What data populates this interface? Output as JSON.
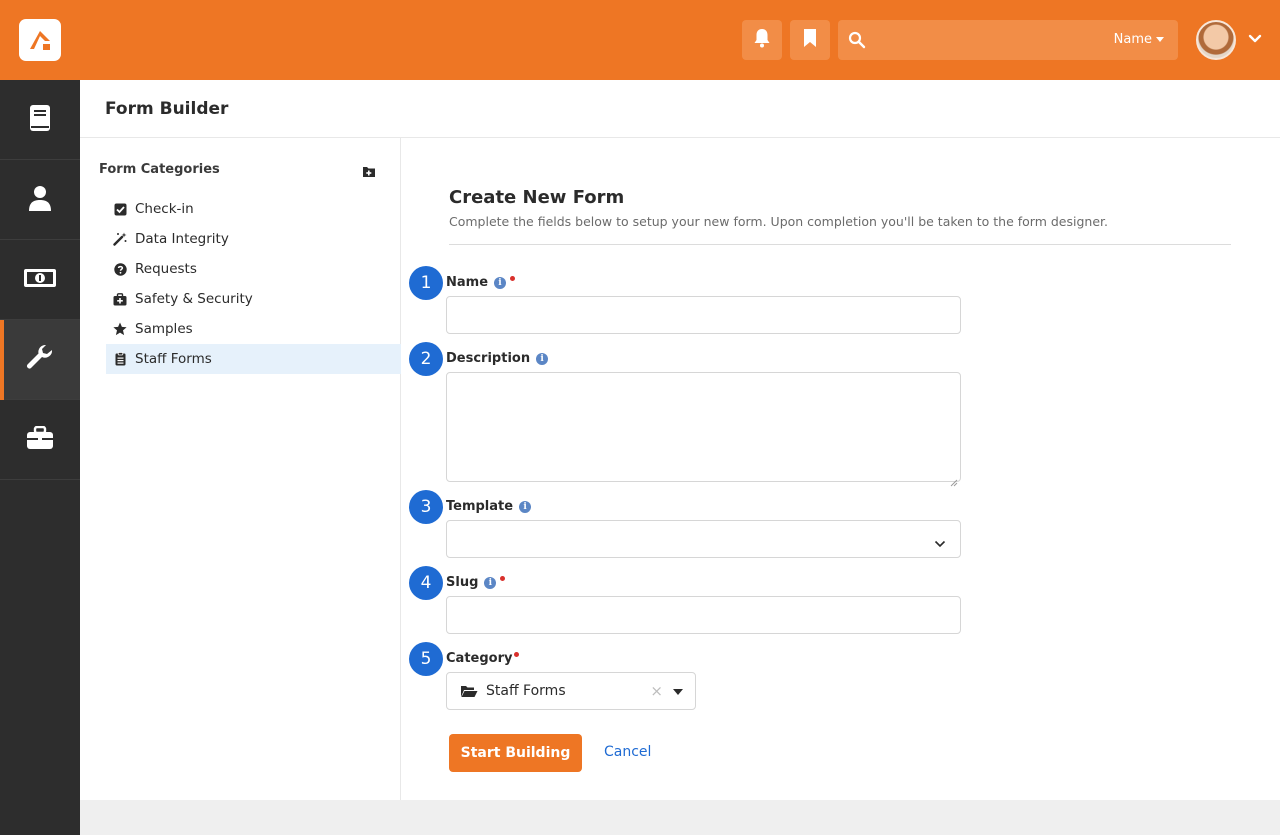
{
  "topbar": {
    "search_type_label": "Name",
    "icons": [
      "bell-icon",
      "bookmark-icon",
      "search-icon",
      "chevron-down-icon"
    ]
  },
  "sidebar": {
    "items": [
      {
        "icon": "book-icon"
      },
      {
        "icon": "person-icon"
      },
      {
        "icon": "money-icon"
      },
      {
        "icon": "wrench-icon",
        "active": true
      },
      {
        "icon": "briefcase-icon"
      }
    ]
  },
  "page": {
    "title": "Form Builder"
  },
  "categories": {
    "title": "Form Categories",
    "items": [
      {
        "label": "Check-in",
        "icon": "checkbox-icon"
      },
      {
        "label": "Data Integrity",
        "icon": "magic-wand-icon"
      },
      {
        "label": "Requests",
        "icon": "question-circle-icon"
      },
      {
        "label": "Safety & Security",
        "icon": "medkit-icon"
      },
      {
        "label": "Samples",
        "icon": "star-icon"
      },
      {
        "label": "Staff Forms",
        "icon": "clipboard-icon",
        "selected": true
      }
    ]
  },
  "form": {
    "title": "Create New Form",
    "subtitle": "Complete the fields below to setup your new form. Upon completion you'll be taken to the form designer.",
    "fields": {
      "name": {
        "number": "1",
        "label": "Name",
        "value": ""
      },
      "description": {
        "number": "2",
        "label": "Description",
        "value": ""
      },
      "template": {
        "number": "3",
        "label": "Template",
        "value": ""
      },
      "slug": {
        "number": "4",
        "label": "Slug",
        "value": ""
      },
      "category": {
        "number": "5",
        "label": "Category",
        "value": "Staff Forms"
      }
    },
    "submit_label": "Start Building",
    "cancel_label": "Cancel"
  },
  "colors": {
    "brand": "#ee7624",
    "sidebar": "#2d2d2d",
    "badge": "#1f6bd3",
    "required": "#d9302c"
  }
}
